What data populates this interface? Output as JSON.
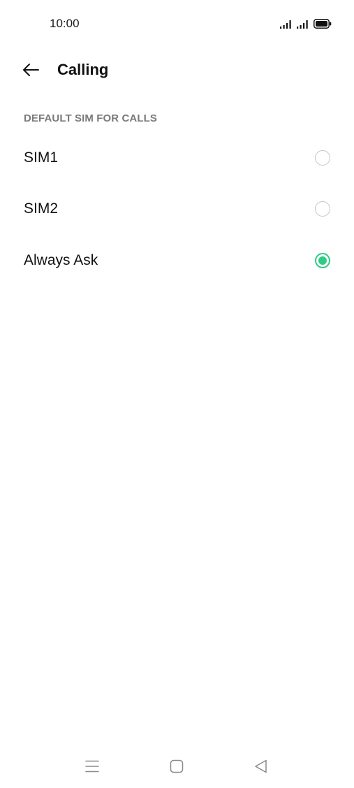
{
  "status_bar": {
    "time": "10:00",
    "icons": [
      "signal-1-icon",
      "signal-2-icon",
      "battery-icon"
    ]
  },
  "app_bar": {
    "back_icon": "arrow-left-icon",
    "title": "Calling"
  },
  "section": {
    "header": "DEFAULT SIM FOR CALLS",
    "options": [
      {
        "label": "SIM1",
        "selected": false
      },
      {
        "label": "SIM2",
        "selected": false
      },
      {
        "label": "Always Ask",
        "selected": true
      }
    ]
  },
  "nav_bar": {
    "icons": [
      "menu-icon",
      "home-icon",
      "back-triangle-icon"
    ]
  },
  "colors": {
    "accent": "#2fcb85",
    "radio_border": "#c4c4c4",
    "section_header": "#7a7a7a",
    "text": "#111111"
  }
}
